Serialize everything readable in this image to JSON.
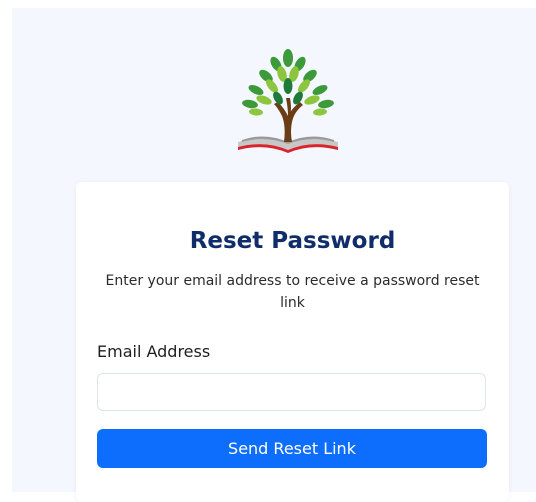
{
  "logo": {
    "icon": "tree-book-logo-icon"
  },
  "card": {
    "title": "Reset Password",
    "subtitle": "Enter your email address to receive a password reset link"
  },
  "form": {
    "email_label": "Email Address",
    "email_value": "",
    "email_placeholder": "",
    "submit_label": "Send Reset Link"
  },
  "colors": {
    "title": "#0f2d6b",
    "button_bg": "#0d6efd",
    "page_bg": "#f4f7fd"
  }
}
